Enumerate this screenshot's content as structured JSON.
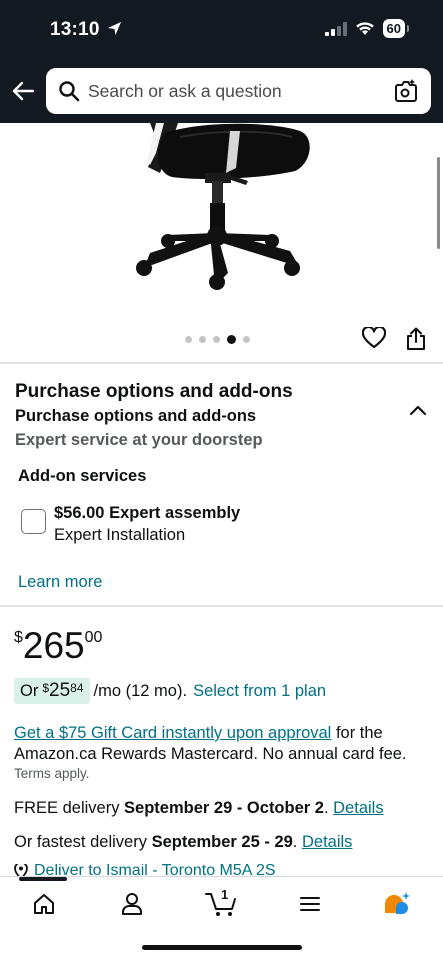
{
  "status_bar": {
    "time": "13:10",
    "battery": "60"
  },
  "header": {
    "search_placeholder": "Search or ask a question"
  },
  "gallery": {
    "image_count": 5,
    "active_index": 3
  },
  "purchase_options": {
    "title": "Purchase options and add-ons",
    "subtitle": "Purchase options and add-ons",
    "description": "Expert service at your doorstep",
    "addon_heading": "Add-on services",
    "addon": {
      "price": "$56.00",
      "name_bold": "Expert assembly",
      "name": "Expert Installation",
      "checked": false
    },
    "learn_more": "Learn more"
  },
  "price": {
    "currency": "$",
    "whole": "265",
    "fraction": "00"
  },
  "plan": {
    "prefix": "Or",
    "currency": "$",
    "whole": "25",
    "fraction": "84",
    "term": "/mo (12 mo).",
    "link": "Select from 1 plan"
  },
  "gift": {
    "link": "Get a $75 Gift Card instantly upon approval",
    "text": "for the Amazon.ca Rewards Mastercard. No annual card fee.",
    "terms": "Terms apply."
  },
  "delivery": {
    "free_prefix": "FREE delivery",
    "free_dates": "September 29 - October 2",
    "free_suffix": ".",
    "free_link": "Details",
    "fast_prefix": "Or fastest delivery",
    "fast_dates": "September 25 - 29",
    "fast_suffix": ".",
    "fast_link": "Details",
    "deliver_to": "Deliver to Ismail - Toronto M5A 2S"
  },
  "tabbar": {
    "cart_count": "1"
  },
  "colors": {
    "header_bg": "#131921",
    "link": "#007185",
    "plan_badge_bg": "#d9f1e8",
    "rufus_orange": "#f08804",
    "rufus_blue": "#1f8ce6"
  }
}
